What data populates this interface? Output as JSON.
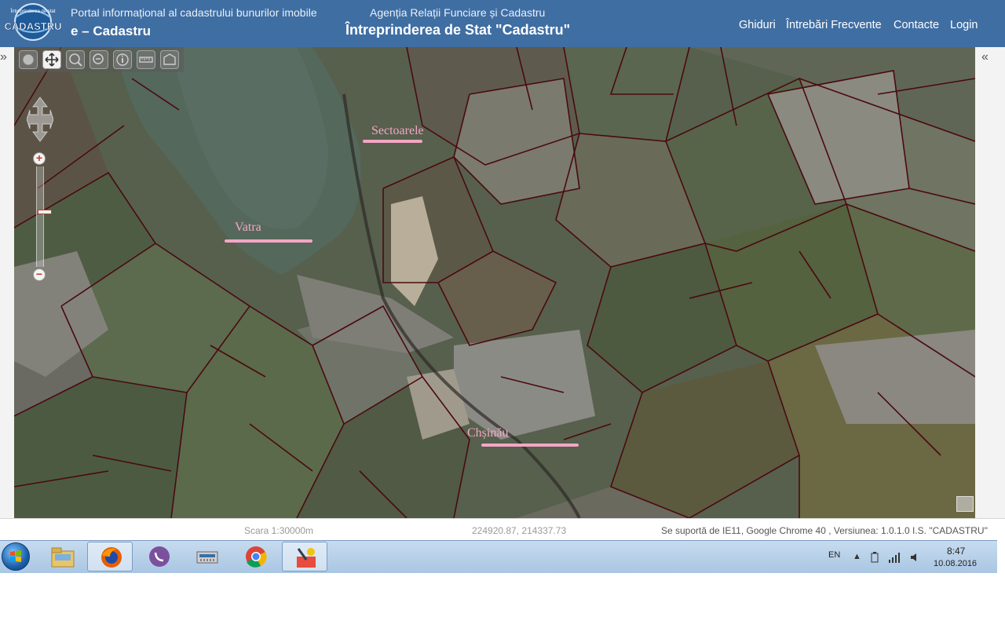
{
  "header": {
    "logo_text_top": "Întreprinderea de stat",
    "logo_text_main": "CADASTRU",
    "portal_subtitle": "Portal informațional al cadastrului bunurilor imobile",
    "portal_title": "e – Cadastru",
    "agency": "Agenția Relații Funciare și Cadastru",
    "company": "Întreprinderea de Stat \"Cadastru\"",
    "nav": [
      "Ghiduri",
      "Întrebări Frecvente",
      "Contacte",
      "Login"
    ]
  },
  "rails": {
    "left_arrow": "»",
    "right_arrow": "«"
  },
  "map": {
    "toolbar_icons": [
      "globe-icon",
      "pan-icon",
      "zoom-in-icon",
      "zoom-out-icon",
      "info-icon",
      "measure-distance-icon",
      "measure-area-icon"
    ],
    "zoom": {
      "plus": "+",
      "minus": "−",
      "level_fraction": 0.55
    },
    "labels": [
      "Sectoarele",
      "Vatra",
      "Chșinău"
    ]
  },
  "status": {
    "scale": "Scara 1:30000m",
    "coordinates": "224920.87, 214337.73",
    "support": "Se suportă de IE11, Google Chrome 40 , Versiunea: 1.0.1.0 I.S. \"CADASTRU\""
  },
  "taskbar": {
    "apps": [
      "file-explorer-icon",
      "firefox-icon",
      "viber-icon",
      "network-scanner-icon",
      "chrome-icon",
      "paint-icon"
    ],
    "language": "EN",
    "time": "8:47",
    "date": "10.08.2016"
  },
  "colors": {
    "header": "#3f6ea3",
    "parcel_border": "#4a0a10",
    "label": "#f4a6c4"
  }
}
